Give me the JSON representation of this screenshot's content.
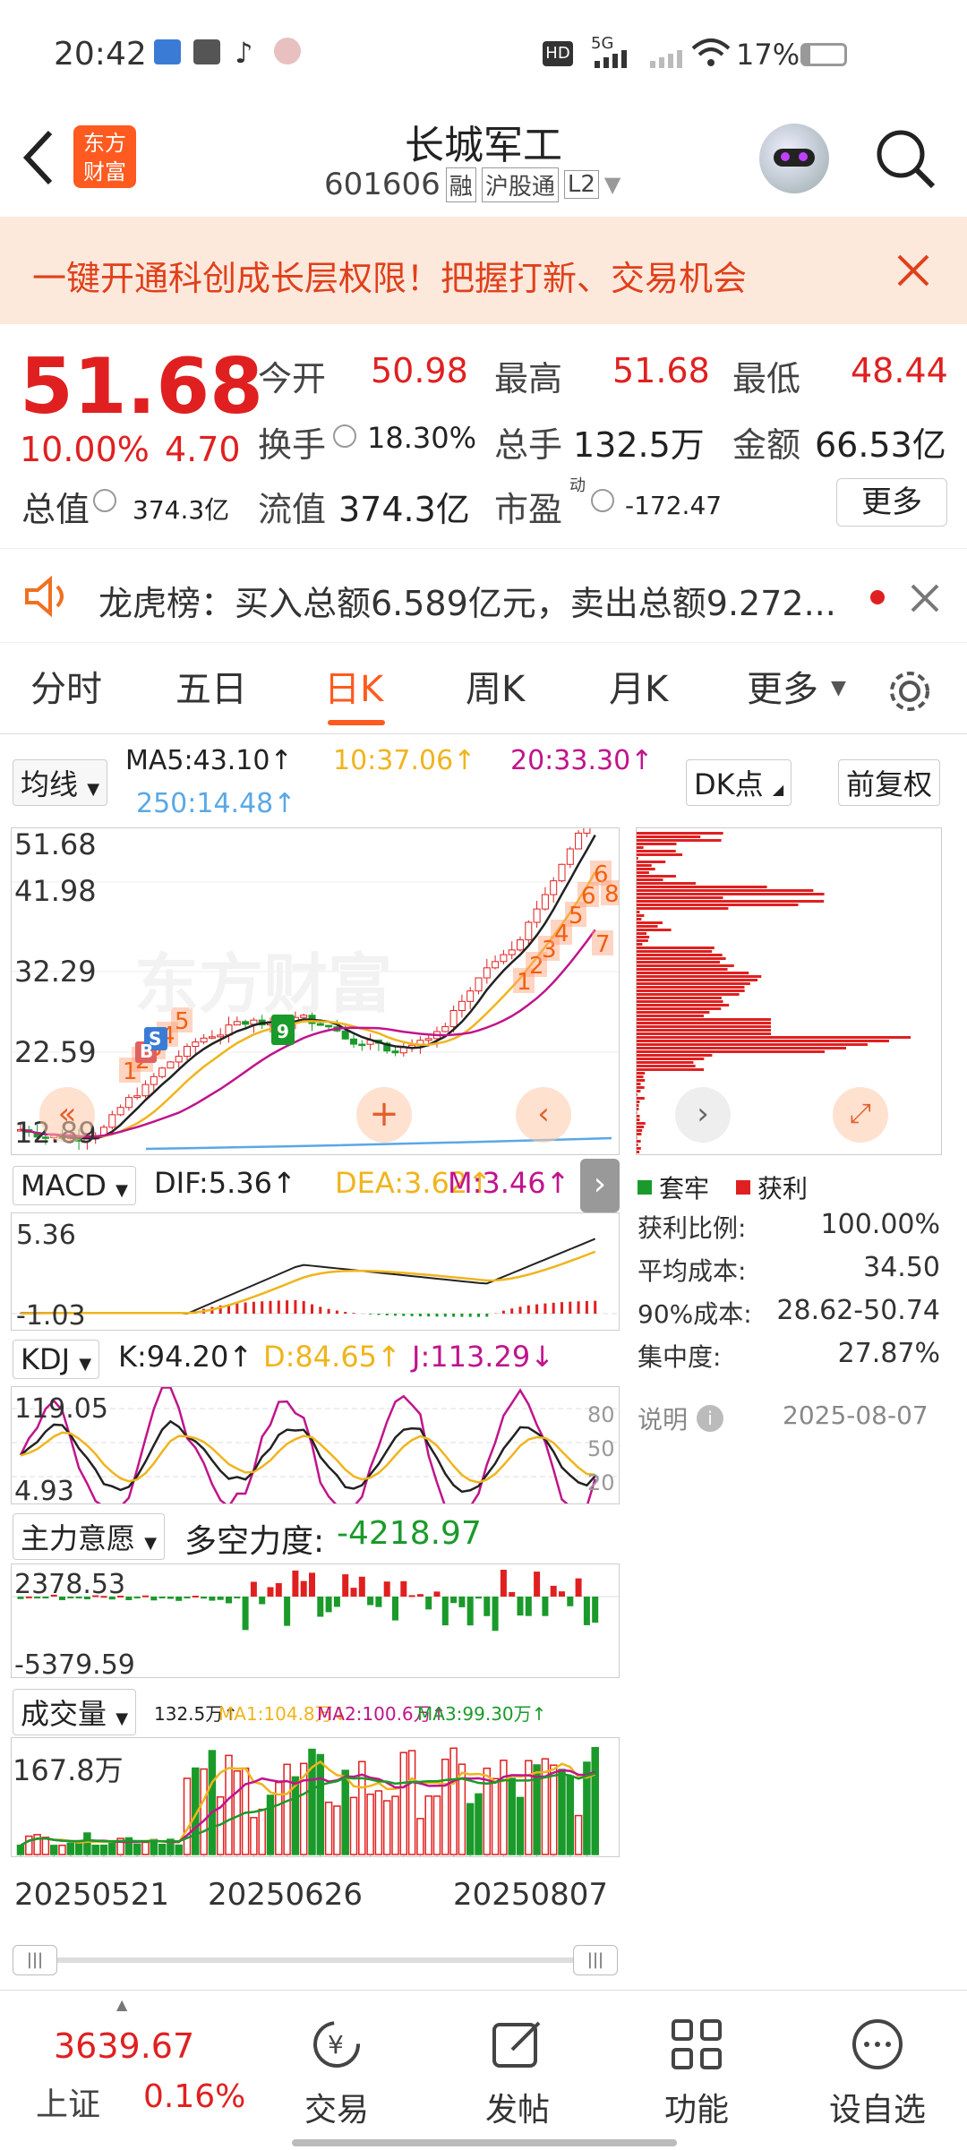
{
  "status_bar": {
    "time": "20:42",
    "signal_label": "5G",
    "battery": "17%"
  },
  "nav": {
    "brand_line1": "东方",
    "brand_line2": "财富",
    "title": "长城军工",
    "code": "601606",
    "tag_rong": "融",
    "tag_hgt": "沪股通",
    "tag_l2": "L2"
  },
  "banner": {
    "text": "一键开通科创成长层权限！把握打新、交易机会"
  },
  "quote": {
    "price": "51.68",
    "change_pct": "10.00%",
    "change_amt": "4.70",
    "open_label": "今开",
    "open": "50.98",
    "high_label": "最高",
    "high": "51.68",
    "low_label": "最低",
    "low": "48.44",
    "turnover_label": "换手",
    "turnover": "18.30%",
    "volume_label": "总手",
    "volume": "132.5万",
    "amount_label": "金额",
    "amount": "66.53亿",
    "mktcap_label": "总值",
    "mktcap": "374.3亿",
    "float_label": "流值",
    "float": "374.3亿",
    "pe_label": "市盈",
    "pe_sup": "动",
    "pe": "-172.47",
    "more": "更多"
  },
  "lhb": {
    "text": "龙虎榜：买入总额6.589亿元，卖出总额9.272..."
  },
  "tabs": [
    "分时",
    "五日",
    "日K",
    "周K",
    "月K",
    "更多"
  ],
  "active_tab": "日K",
  "kline": {
    "ma_dropdown": "均线",
    "ma5": "MA5:43.10↑",
    "ma10": "10:37.06↑",
    "ma20": "20:33.30↑",
    "ma250": "250:14.48↑",
    "dk_button": "DK点",
    "fq_button": "前复权",
    "y_labels": [
      "51.68",
      "41.98",
      "32.29",
      "22.59",
      "12.89"
    ],
    "watermark": "东方财富",
    "numbers": [
      "1",
      "2",
      "3",
      "4",
      "5",
      "6",
      "8",
      "7",
      "9"
    ],
    "markers": [
      "B",
      "S",
      "S"
    ]
  },
  "chips": {
    "legend_loss": "套牢",
    "legend_profit": "获利",
    "rows": [
      {
        "k": "获利比例:",
        "v": "100.00%"
      },
      {
        "k": "平均成本:",
        "v": "34.50"
      },
      {
        "k": "90%成本:",
        "v": "28.62-50.74"
      },
      {
        "k": "集中度:",
        "v": "27.87%"
      }
    ],
    "note": "说明",
    "date": "2025-08-07"
  },
  "macd": {
    "dropdown": "MACD",
    "dif": "DIF:5.36↑",
    "dea": "DEA:3.62↑",
    "m": "M:3.46↑",
    "y_top": "5.36",
    "y_bottom": "-1.03"
  },
  "kdj": {
    "dropdown": "KDJ",
    "k": "K:94.20↑",
    "d": "D:84.65↑",
    "j": "J:113.29↓",
    "y_top": "119.05",
    "y_bottom": "4.93",
    "ref80": "80",
    "ref50": "50",
    "ref20": "20"
  },
  "zlyy": {
    "dropdown": "主力意愿",
    "label": "多空力度:",
    "value": "-4218.97",
    "y_top": "2378.53",
    "y_bottom": "-5379.59"
  },
  "vol": {
    "dropdown": "成交量",
    "vol": "132.5万↑",
    "ma1": "MA1:104.8万↓",
    "ma2": "MA2:100.6万↑",
    "ma3": "MA3:99.30万↑",
    "y_top": "167.8万",
    "dates": [
      "20250521",
      "20250626",
      "20250807"
    ]
  },
  "bottom": {
    "index_value": "3639.67",
    "index_name": "上证",
    "index_change": "0.16%",
    "items": [
      "交易",
      "发帖",
      "功能",
      "设自选"
    ]
  },
  "colors": {
    "up": "#e02020",
    "down": "#1a9a2a",
    "brand": "#ff5a1f",
    "ma5": "#222222",
    "ma10": "#f0b41c",
    "ma20": "#c0148c",
    "ma250": "#5aa8e6"
  }
}
